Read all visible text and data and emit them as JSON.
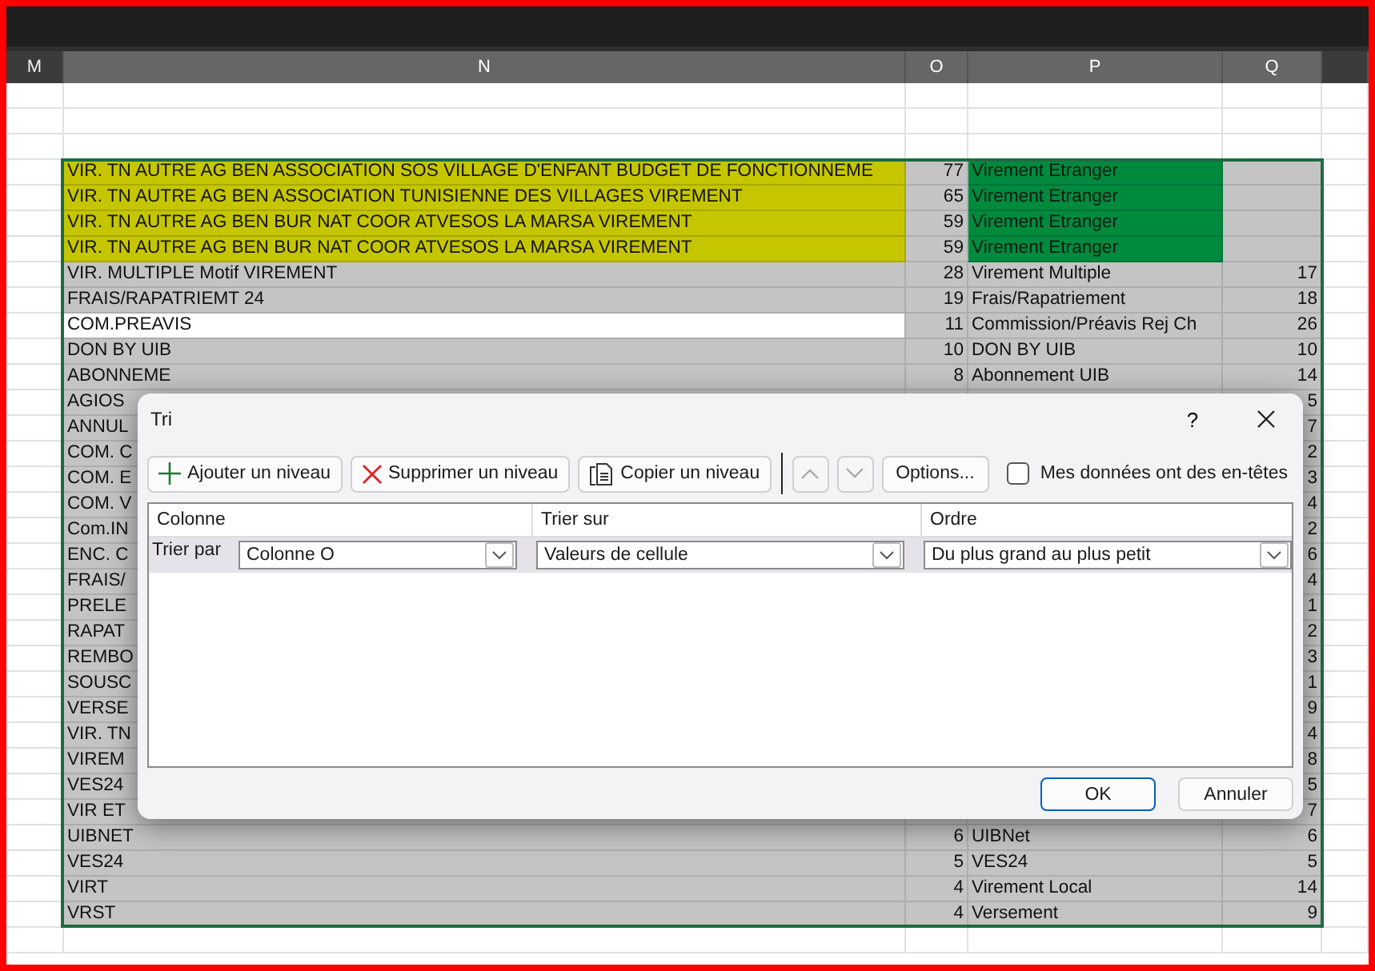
{
  "sheet": {
    "columns": [
      {
        "label": "M",
        "selected": false
      },
      {
        "label": "N",
        "selected": true
      },
      {
        "label": "O",
        "selected": true
      },
      {
        "label": "P",
        "selected": true
      },
      {
        "label": "Q",
        "selected": true
      }
    ],
    "rows": [
      {
        "kind": "flagged",
        "description": "VIR. TN AUTRE AG BEN ASSOCIATION SOS VILLAGE D'ENFANT BUDGET DE FONCTIONNEME",
        "count": "77",
        "category": "Virement Etranger"
      },
      {
        "kind": "flagged",
        "description": "VIR. TN AUTRE AG BEN ASSOCIATION TUNISIENNE DES VILLAGES VIREMENT",
        "count": "65",
        "category": "Virement Etranger"
      },
      {
        "kind": "flagged",
        "description": "VIR. TN AUTRE AG BEN BUR NAT COOR ATVESOS LA MARSA VIREMENT",
        "count": "59",
        "category": "Virement Etranger"
      },
      {
        "kind": "flagged",
        "description": "VIR. TN AUTRE AG BEN BUR NAT COOR ATVESOS LA MARSA VIREMENT",
        "count": "59",
        "category": "Virement Etranger"
      },
      {
        "kind": "normal",
        "description": "VIR. MULTIPLE Motif VIREMENT",
        "count": "28",
        "category": "Virement Multiple",
        "column_q": "17"
      },
      {
        "kind": "normal",
        "description": "FRAIS/RAPATRIEMT 24",
        "count": "19",
        "category": "Frais/Rapatriement",
        "column_q": "18"
      },
      {
        "kind": "plain",
        "description": "COM.PREAVIS",
        "count": "11",
        "category": "Commission/Préavis Rej Ch",
        "column_q": "26"
      },
      {
        "kind": "normal",
        "description": "DON BY UIB",
        "count": "10",
        "category": "DON BY UIB",
        "column_q": "10"
      },
      {
        "kind": "normal",
        "description": "ABONNEME",
        "count": "8",
        "category": "Abonnement UIB",
        "column_q": "14"
      },
      {
        "kind": "normal",
        "description": "AGIOS",
        "column_q": "5"
      },
      {
        "kind": "normal",
        "description": "ANNUL",
        "column_q": "7"
      },
      {
        "kind": "normal",
        "description": "COM. C",
        "column_q": "2"
      },
      {
        "kind": "normal",
        "description": "COM. E",
        "column_q": "3"
      },
      {
        "kind": "normal",
        "description": "COM. V",
        "column_q": "4"
      },
      {
        "kind": "normal",
        "description": "Com.IN",
        "column_q": "2"
      },
      {
        "kind": "normal",
        "description": "ENC. C",
        "column_q": "6"
      },
      {
        "kind": "normal",
        "description": "FRAIS/",
        "column_q": "4"
      },
      {
        "kind": "normal",
        "description": "PRELE",
        "column_q": "1"
      },
      {
        "kind": "normal",
        "description": "RAPAT",
        "column_q": "2"
      },
      {
        "kind": "normal",
        "description": "REMBO",
        "column_q": "3"
      },
      {
        "kind": "normal",
        "description": "SOUSC",
        "column_q": "1"
      },
      {
        "kind": "normal",
        "description": "VERSE",
        "column_q": "9"
      },
      {
        "kind": "normal",
        "description": "VIR. TN",
        "column_q": "4"
      },
      {
        "kind": "normal",
        "description": "VIREM",
        "column_q": "8"
      },
      {
        "kind": "normal",
        "description": "VES24",
        "column_q": "5"
      },
      {
        "kind": "normal",
        "description": "VIR ET",
        "column_q": "7"
      },
      {
        "kind": "normal",
        "description": "UIBNET",
        "count": "6",
        "category": "UIBNet",
        "column_q": "6"
      },
      {
        "kind": "normal",
        "description": "VES24",
        "count": "5",
        "category": "VES24",
        "column_q": "5"
      },
      {
        "kind": "normal",
        "description": "VIRT",
        "count": "4",
        "category": "Virement Local",
        "column_q": "14"
      },
      {
        "kind": "normal",
        "description": "VRST",
        "count": "4",
        "category": "Versement",
        "column_q": "9"
      }
    ]
  },
  "dialog": {
    "title": "Tri",
    "help": "?",
    "toolbar": [
      {
        "label": "Ajouter un niveau",
        "kind": "add"
      },
      {
        "label": "Supprimer un niveau",
        "kind": "delete"
      },
      {
        "label": "Copier un niveau",
        "kind": "copy"
      }
    ],
    "move_buttons": [
      {
        "kind": "up",
        "disabled": true
      },
      {
        "kind": "down",
        "disabled": true
      }
    ],
    "options": "Options...",
    "headers_checkbox": {
      "label": "Mes données ont des en-têtes",
      "checked": false
    },
    "headers": [
      "Colonne",
      "Trier sur",
      "Ordre"
    ],
    "levels": [
      {
        "label": "Trier par",
        "column": "Colonne O",
        "sort_on": "Valeurs de cellule",
        "order": "Du plus grand au plus petit",
        "selected": true
      }
    ],
    "buttons": [
      {
        "label": "OK",
        "kind": "default"
      },
      {
        "label": "Annuler",
        "kind": "normal"
      }
    ]
  }
}
